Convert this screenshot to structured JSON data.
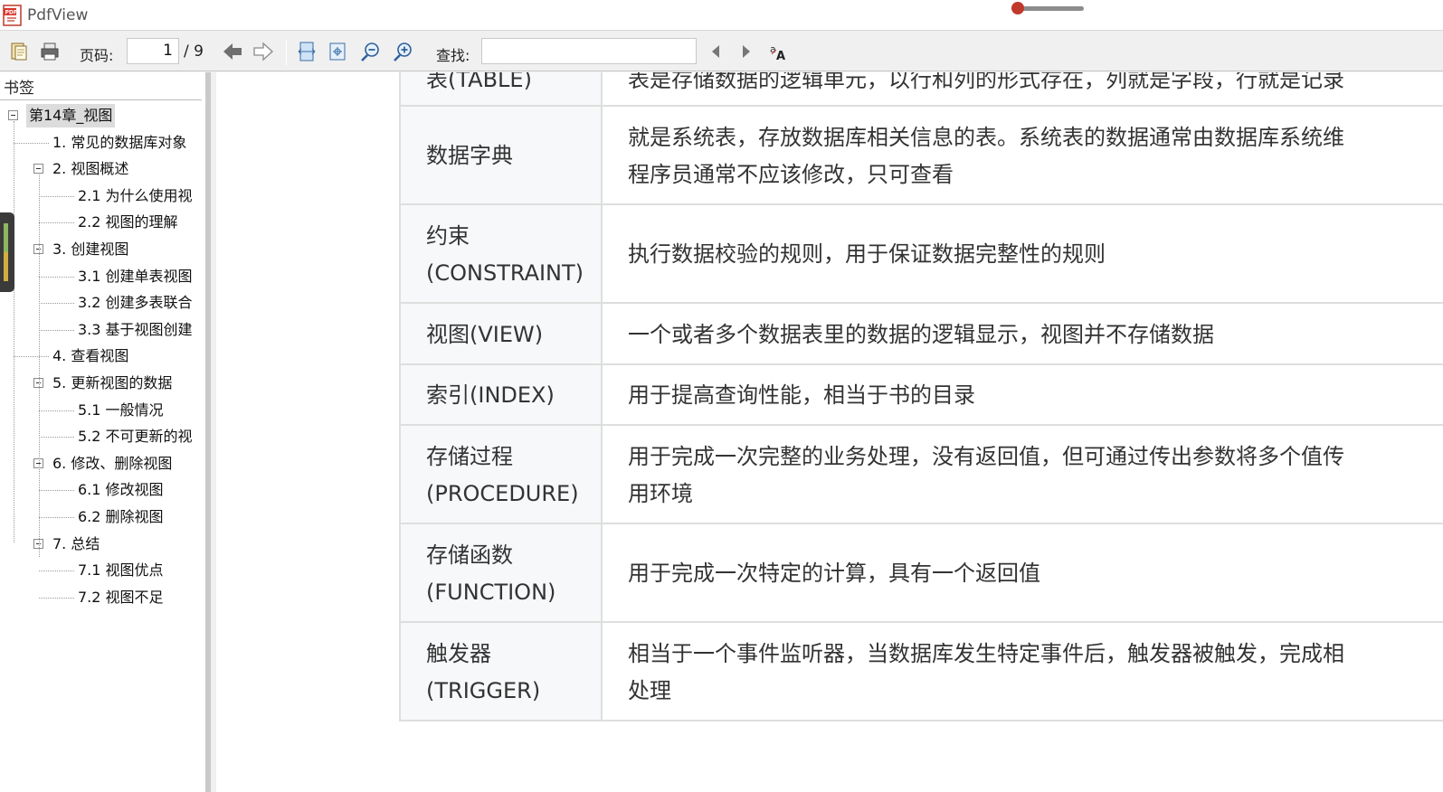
{
  "app": {
    "title": "PdfView",
    "icon": "pdf-app-icon"
  },
  "toolbar": {
    "page_label": "页码:",
    "page_value": "1",
    "page_total": "/ 9",
    "search_label": "查找:",
    "search_value": ""
  },
  "sidebar": {
    "title": "书签",
    "items": [
      {
        "label": "第14章_视图",
        "level": 0,
        "toggle": true
      },
      {
        "label": "1. 常见的数据库对象",
        "level": 1,
        "toggle": false
      },
      {
        "label": "2. 视图概述",
        "level": 1,
        "toggle": true
      },
      {
        "label": "2.1 为什么使用视",
        "level": 2,
        "toggle": false
      },
      {
        "label": "2.2 视图的理解",
        "level": 2,
        "toggle": false
      },
      {
        "label": "3. 创建视图",
        "level": 1,
        "toggle": true
      },
      {
        "label": "3.1 创建单表视图",
        "level": 2,
        "toggle": false
      },
      {
        "label": "3.2 创建多表联合",
        "level": 2,
        "toggle": false
      },
      {
        "label": "3.3 基于视图创建",
        "level": 2,
        "toggle": false
      },
      {
        "label": "4. 查看视图",
        "level": 1,
        "toggle": false
      },
      {
        "label": "5. 更新视图的数据",
        "level": 1,
        "toggle": true
      },
      {
        "label": "5.1 一般情况",
        "level": 2,
        "toggle": false
      },
      {
        "label": "5.2 不可更新的视",
        "level": 2,
        "toggle": false
      },
      {
        "label": "6. 修改、删除视图",
        "level": 1,
        "toggle": true
      },
      {
        "label": "6.1 修改视图",
        "level": 2,
        "toggle": false
      },
      {
        "label": "6.2 删除视图",
        "level": 2,
        "toggle": false
      },
      {
        "label": "7. 总结",
        "level": 1,
        "toggle": true
      },
      {
        "label": "7.1 视图优点",
        "level": 2,
        "toggle": false
      },
      {
        "label": "7.2 视图不足",
        "level": 2,
        "toggle": false
      }
    ]
  },
  "doc": {
    "rows": [
      {
        "a": [
          "表(TABLE)"
        ],
        "b": [
          "表是存储数据的逻辑单元，以行和列的形式存在，列就是字段，行就是记录"
        ]
      },
      {
        "a": [
          "数据字典"
        ],
        "b": [
          "就是系统表，存放数据库相关信息的表。系统表的数据通常由数据库系统维",
          "程序员通常不应该修改，只可查看"
        ]
      },
      {
        "a": [
          "约束",
          "(CONSTRAINT)"
        ],
        "b": [
          "执行数据校验的规则，用于保证数据完整性的规则"
        ]
      },
      {
        "a": [
          "视图(VIEW)"
        ],
        "b": [
          "一个或者多个数据表里的数据的逻辑显示，视图并不存储数据"
        ]
      },
      {
        "a": [
          "索引(INDEX)"
        ],
        "b": [
          "用于提高查询性能，相当于书的目录"
        ]
      },
      {
        "a": [
          "存储过程",
          "(PROCEDURE)"
        ],
        "b": [
          "用于完成一次完整的业务处理，没有返回值，但可通过传出参数将多个值传",
          "用环境"
        ]
      },
      {
        "a": [
          "存储函数",
          "(FUNCTION)"
        ],
        "b": [
          "用于完成一次特定的计算，具有一个返回值"
        ]
      },
      {
        "a": [
          "触发器",
          "(TRIGGER)"
        ],
        "b": [
          "相当于一个事件监听器，当数据库发生特定事件后，触发器被触发，完成相",
          "处理"
        ]
      }
    ]
  }
}
